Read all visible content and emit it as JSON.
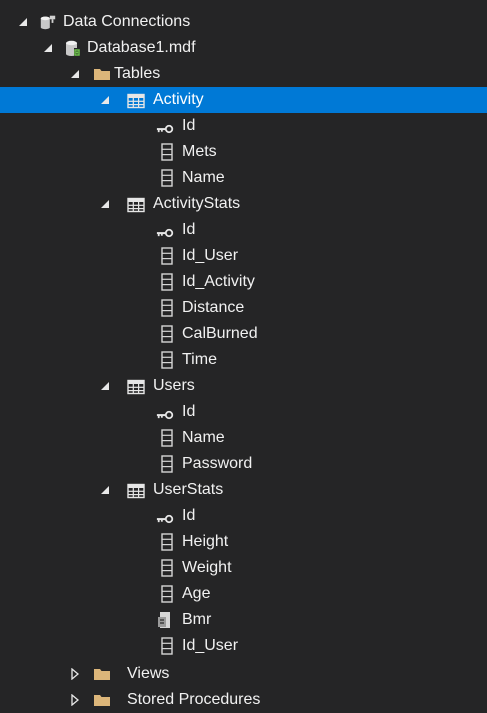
{
  "explorer": {
    "data_connections": "Data Connections",
    "database": "Database1.mdf",
    "tables_folder": "Tables",
    "tables": [
      {
        "name": "Activity",
        "columns": [
          {
            "name": "Id",
            "type": "key"
          },
          {
            "name": "Mets",
            "type": "column"
          },
          {
            "name": "Name",
            "type": "column"
          }
        ]
      },
      {
        "name": "ActivityStats",
        "columns": [
          {
            "name": "Id",
            "type": "key"
          },
          {
            "name": "Id_User",
            "type": "column"
          },
          {
            "name": "Id_Activity",
            "type": "column"
          },
          {
            "name": "Distance",
            "type": "column"
          },
          {
            "name": "CalBurned",
            "type": "column"
          },
          {
            "name": "Time",
            "type": "column"
          }
        ]
      },
      {
        "name": "Users",
        "columns": [
          {
            "name": "Id",
            "type": "key"
          },
          {
            "name": "Name",
            "type": "column"
          },
          {
            "name": "Password",
            "type": "column"
          }
        ]
      },
      {
        "name": "UserStats",
        "columns": [
          {
            "name": "Id",
            "type": "key"
          },
          {
            "name": "Height",
            "type": "column"
          },
          {
            "name": "Weight",
            "type": "column"
          },
          {
            "name": "Age",
            "type": "column"
          },
          {
            "name": "Bmr",
            "type": "computed"
          },
          {
            "name": "Id_User",
            "type": "column"
          }
        ]
      }
    ],
    "views_folder": "Views",
    "procedures_folder": "Stored Procedures",
    "selected_table": "Activity"
  },
  "colors": {
    "background": "#252526",
    "selection": "#0079d6",
    "folder": "#dcb67a",
    "text": "#f1f1f1"
  }
}
